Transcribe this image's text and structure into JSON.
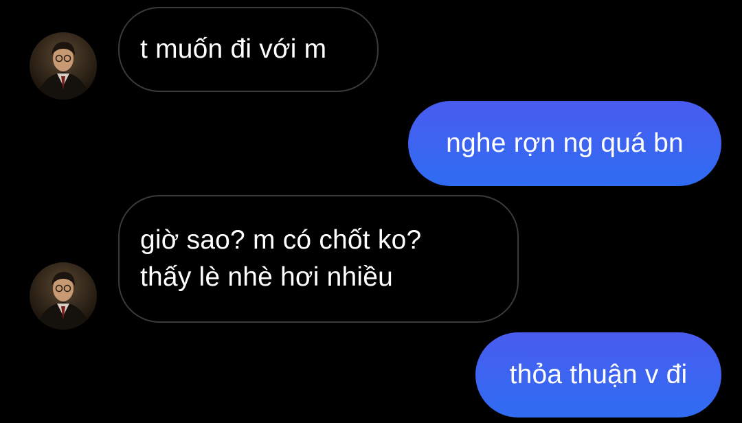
{
  "colors": {
    "background": "#000000",
    "incoming_border": "#3a3a3a",
    "outgoing_bubble_top": "#4a5cf0",
    "outgoing_bubble_bottom": "#2f6cf2",
    "text": "#ffffff"
  },
  "messages": [
    {
      "direction": "incoming",
      "text": "t muốn đi với m",
      "has_avatar": true
    },
    {
      "direction": "outgoing",
      "text": "nghe rợn ng quá bn"
    },
    {
      "direction": "incoming",
      "text": "giờ sao? m có chốt ko?\nthấy lè nhè hơi nhiều",
      "has_avatar": true
    },
    {
      "direction": "outgoing",
      "text": "thỏa thuận v đi"
    }
  ],
  "contact": {
    "avatar_icon": "profile-photo"
  }
}
